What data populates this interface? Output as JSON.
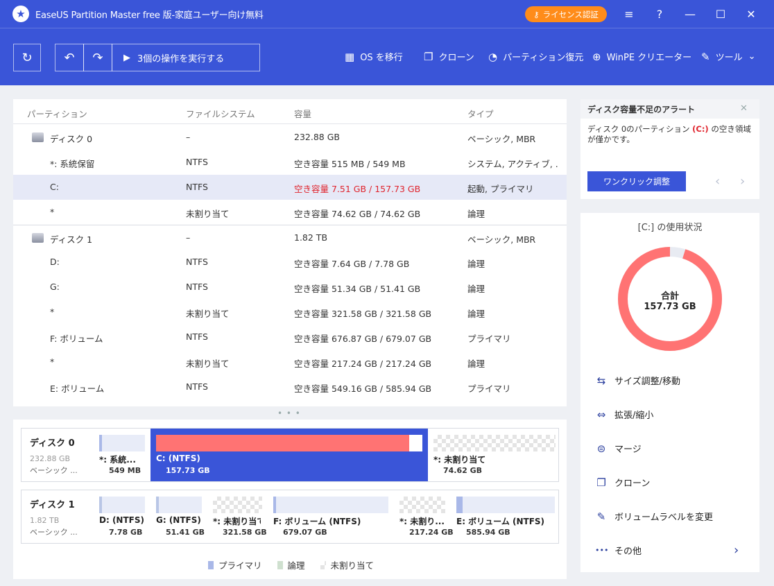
{
  "titlebar": {
    "app_title": "EaseUS Partition Master free 版-家庭ユーザー向け無料",
    "license_label": "ライセンス認証",
    "buttons": {
      "menu": "≡",
      "help": "?",
      "minimize": "—",
      "maximize": "☐",
      "close": "✕"
    }
  },
  "toolbar": {
    "refresh_icon": "↻",
    "undo_icon": "↶",
    "redo_icon": "↷",
    "execute_label": "3個の操作を実行する",
    "tools": [
      {
        "icon": "▦",
        "label": "OS を移行"
      },
      {
        "icon": "❐",
        "label": "クローン"
      },
      {
        "icon": "◔",
        "label": "パーティション復元"
      },
      {
        "icon": "⊕",
        "label": "WinPE クリエーター"
      },
      {
        "icon": "✎",
        "label": "ツール"
      }
    ],
    "tools_chevron": "⌄"
  },
  "partition_table": {
    "headers": [
      "パーティション",
      "ファイルシステム",
      "容量",
      "タイプ"
    ],
    "rows": [
      {
        "kind": "disk",
        "name": "ディスク 0",
        "fs": "–",
        "capacity": "232.88 GB",
        "type": "ベーシック, MBR"
      },
      {
        "kind": "part",
        "name": "*: 系統保留",
        "fs": "NTFS",
        "capacity": "空き容量 515 MB / 549 MB",
        "type": "システム, アクティブ, …"
      },
      {
        "kind": "part",
        "name": "C:",
        "fs": "NTFS",
        "capacity": "空き容量 7.51 GB / 157.73 GB",
        "type": "起動, プライマリ",
        "selected": true,
        "warning": true
      },
      {
        "kind": "part",
        "name": "*",
        "fs": "未割り当て",
        "capacity": "空き容量 74.62 GB / 74.62 GB",
        "type": "論理"
      },
      {
        "kind": "disk",
        "name": "ディスク 1",
        "fs": "–",
        "capacity": "1.82 TB",
        "type": "ベーシック, MBR"
      },
      {
        "kind": "part",
        "name": "D:",
        "fs": "NTFS",
        "capacity": "空き容量 7.64 GB / 7.78 GB",
        "type": "論理"
      },
      {
        "kind": "part",
        "name": "G:",
        "fs": "NTFS",
        "capacity": "空き容量 51.34 GB / 51.41 GB",
        "type": "論理"
      },
      {
        "kind": "part",
        "name": "*",
        "fs": "未割り当て",
        "capacity": "空き容量 321.58 GB / 321.58 GB",
        "type": "論理"
      },
      {
        "kind": "part",
        "name": "F: ボリューム",
        "fs": "NTFS",
        "capacity": "空き容量 676.87 GB / 679.07 GB",
        "type": "プライマリ"
      },
      {
        "kind": "part",
        "name": "*",
        "fs": "未割り当て",
        "capacity": "空き容量 217.24 GB / 217.24 GB",
        "type": "論理"
      },
      {
        "kind": "part",
        "name": "E: ボリューム",
        "fs": "NTFS",
        "capacity": "空き容量 549.16 GB / 585.94 GB",
        "type": "プライマリ"
      }
    ]
  },
  "splitter_dots": "• • •",
  "disk_map": {
    "disks": [
      {
        "name": "ディスク 0",
        "size": "232.88 GB",
        "type": "ベーシック ...",
        "segments": [
          {
            "label": "*: 系統...",
            "size": "549 MB",
            "kind": "primary",
            "used_fraction": 0.06
          },
          {
            "label": "C: (NTFS)",
            "size": "157.73 GB",
            "kind": "primary",
            "used_fraction": 0.95,
            "selected": true
          },
          {
            "label": "*: 未割り当て",
            "size": "74.62 GB",
            "kind": "unallocated",
            "used_fraction": 0
          }
        ]
      },
      {
        "name": "ディスク 1",
        "size": "1.82 TB",
        "type": "ベーシック ...",
        "segments": [
          {
            "label": "D: (NTFS)",
            "size": "7.78 GB",
            "kind": "logical",
            "used_fraction": 0.02
          },
          {
            "label": "G: (NTFS)",
            "size": "51.41 GB",
            "kind": "logical",
            "used_fraction": 0.01
          },
          {
            "label": "*: 未割り当て",
            "size": "321.58 GB",
            "kind": "unallocated",
            "used_fraction": 0
          },
          {
            "label": "F: ボリューム (NTFS)",
            "size": "679.07 GB",
            "kind": "primary",
            "used_fraction": 0.01
          },
          {
            "label": "*: 未割り...",
            "size": "217.24 GB",
            "kind": "unallocated",
            "used_fraction": 0
          },
          {
            "label": "E: ボリューム (NTFS)",
            "size": "585.94 GB",
            "kind": "primary",
            "used_fraction": 0.06
          }
        ]
      }
    ]
  },
  "legend": [
    {
      "label": "プライマリ",
      "color": "#a9b8e8"
    },
    {
      "label": "論理",
      "color": "#cfe0cf"
    },
    {
      "label": "未割り当て",
      "color": "#e4e4e4"
    }
  ],
  "alert": {
    "title": "ディスク容量不足のアラート",
    "close_icon": "✕",
    "message_before": "ディスク 0のパーティション ",
    "message_drive": "(C:)",
    "message_after": " の空き領域が僅かです。",
    "button_label": "ワンクリック調整",
    "prev_icon": "‹",
    "next_icon": "›"
  },
  "usage_panel": {
    "title": "[C:] の使用状況",
    "total_label": "合計",
    "total_value": "157.73 GB",
    "used_fraction": 0.952,
    "used_color": "#ff7373",
    "free_color": "#e8ebf2",
    "actions": [
      {
        "icon": "⇆",
        "label": "サイズ調整/移動",
        "name": "resize-move"
      },
      {
        "icon": "⇔",
        "label": "拡張/縮小",
        "name": "extend-shrink"
      },
      {
        "icon": "⊜",
        "label": "マージ",
        "name": "merge"
      },
      {
        "icon": "❐",
        "label": "クローン",
        "name": "clone"
      },
      {
        "icon": "✎",
        "label": "ボリュームラベルを変更",
        "name": "change-label"
      },
      {
        "icon": "•••",
        "label": "その他",
        "name": "more"
      }
    ],
    "more_chevron": "›"
  },
  "colors": {
    "brand_blue": "#3a55d8",
    "license_orange": "#ff8c1a",
    "warning_red": "#e0242d",
    "selected_segment": "#3a55d8",
    "c_bar_fill": "#ff7373"
  }
}
